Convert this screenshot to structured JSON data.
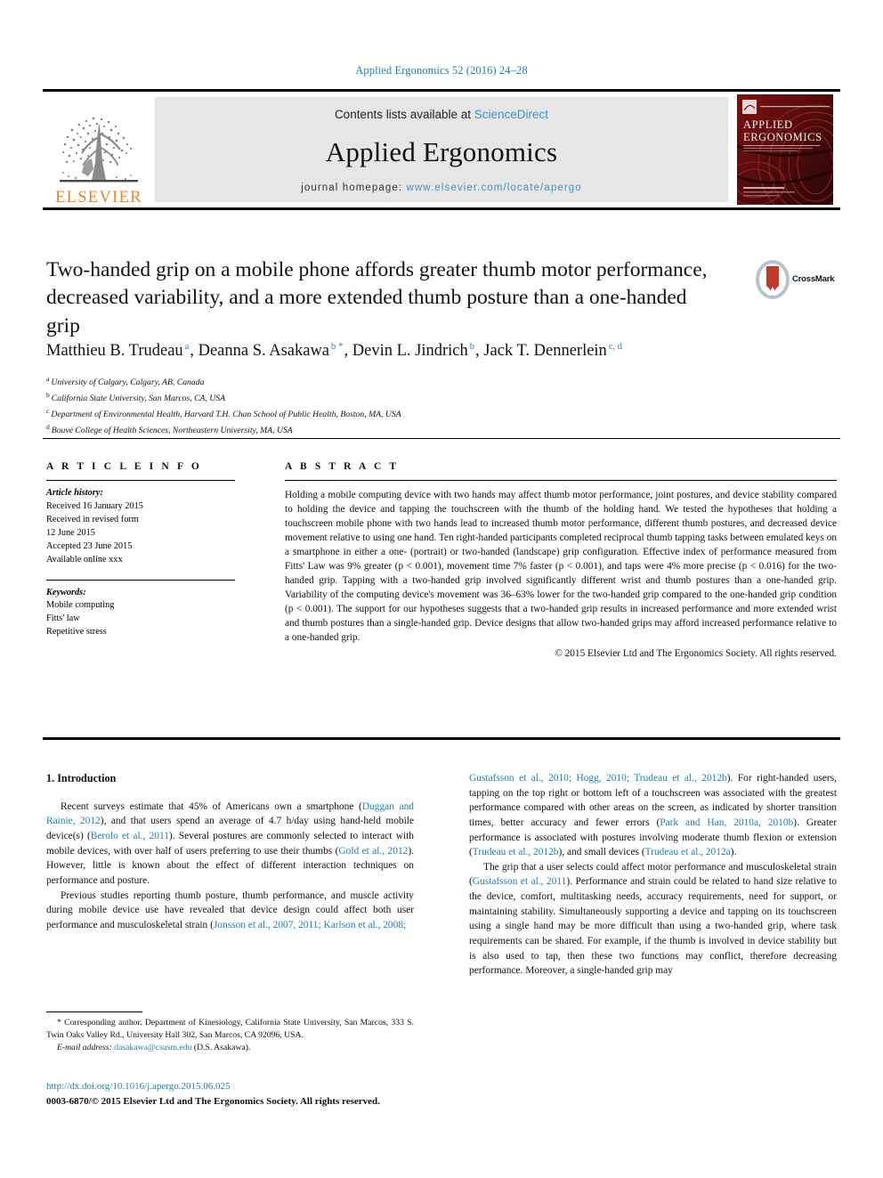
{
  "running_head": "Applied Ergonomics 52 (2016) 24–28",
  "masthead": {
    "elsevier_wordmark": "ELSEVIER",
    "contents_prefix": "Contents lists available at ",
    "contents_link": "ScienceDirect",
    "journal_name": "Applied Ergonomics",
    "homepage_prefix": "journal homepage: ",
    "homepage_url": "www.elsevier.com/locate/apergo",
    "cover_title_line1": "APPLIED",
    "cover_title_line2": "ERGONOMICS"
  },
  "crossmark": {
    "label": "CrossMark"
  },
  "article": {
    "title": "Two-handed grip on a mobile phone affords greater thumb motor performance, decreased variability, and a more extended thumb posture than a one-handed grip",
    "authors": [
      {
        "name": "Matthieu B. Trudeau",
        "marks": "a",
        "corresponding": false
      },
      {
        "name": "Deanna S. Asakawa",
        "marks": "b",
        "corresponding": true
      },
      {
        "name": "Devin L. Jindrich",
        "marks": "b",
        "corresponding": false
      },
      {
        "name": "Jack T. Dennerlein",
        "marks": "c, d",
        "corresponding": false
      }
    ],
    "affiliations": [
      {
        "mark": "a",
        "text": "University of Calgary, Calgary, AB, Canada"
      },
      {
        "mark": "b",
        "text": "California State University, San Marcos, CA, USA"
      },
      {
        "mark": "c",
        "text": "Department of Environmental Health, Harvard T.H. Chan School of Public Health, Boston, MA, USA"
      },
      {
        "mark": "d",
        "text": "Bouvé College of Health Sciences, Northeastern University, MA, USA"
      }
    ]
  },
  "article_info": {
    "heading": "A R T I C L E  I N F O",
    "history_label": "Article history:",
    "history_lines": [
      "Received 16 January 2015",
      "Received in revised form",
      "12 June 2015",
      "Accepted 23 June 2015",
      "Available online xxx"
    ],
    "keywords_label": "Keywords:",
    "keywords": [
      "Mobile computing",
      "Fitts' law",
      "Repetitive stress"
    ]
  },
  "abstract": {
    "heading": "A B S T R A C T",
    "body": "Holding a mobile computing device with two hands may affect thumb motor performance, joint postures, and device stability compared to holding the device and tapping the touchscreen with the thumb of the holding hand. We tested the hypotheses that holding a touchscreen mobile phone with two hands lead to increased thumb motor performance, different thumb postures, and decreased device movement relative to using one hand. Ten right-handed participants completed reciprocal thumb tapping tasks between emulated keys on a smartphone in either a one- (portrait) or two-handed (landscape) grip configuration. Effective index of performance measured from Fitts' Law was 9% greater (p < 0.001), movement time 7% faster (p < 0.001), and taps were 4% more precise (p < 0.016) for the two-handed grip. Tapping with a two-handed grip involved significantly different wrist and thumb postures than a one-handed grip. Variability of the computing device's movement was 36–63% lower for the two-handed grip compared to the one-handed grip condition (p < 0.001). The support for our hypotheses suggests that a two-handed grip results in increased performance and more extended wrist and thumb postures than a single-handed grip. Device designs that allow two-handed grips may afford increased performance relative to a one-handed grip.",
    "copyright": "© 2015 Elsevier Ltd and The Ergonomics Society. All rights reserved."
  },
  "introduction": {
    "heading": "1. Introduction",
    "left_paragraph_1_a": "Recent surveys estimate that 45% of Americans own a smartphone (",
    "left_ref_1": "Duggan and Rainie, 2012",
    "left_paragraph_1_b": "), and that users spend an average of 4.7 h/day using hand-held mobile device(s) (",
    "left_ref_2": "Berolo et al., 2011",
    "left_paragraph_1_c": "). Several postures are commonly selected to interact with mobile devices, with over half of users preferring to use their thumbs (",
    "left_ref_3": "Gold et al., 2012",
    "left_paragraph_1_d": "). However, little is known about the effect of different interaction techniques on performance and posture.",
    "left_paragraph_2_a": "Previous studies reporting thumb posture, thumb performance, and muscle activity during mobile device use have revealed that device design could affect both user performance and musculoskeletal strain (",
    "left_ref_4": "Jonsson et al., 2007, 2011; Karlson et al., 2008;",
    "right_ref_1": "Gustafsson et al., 2010; Hogg, 2010; Trudeau et al., 2012b",
    "right_paragraph_1_a": "). For right-handed users, tapping on the top right or bottom left of a touchscreen was associated with the greatest performance compared with other areas on the screen, as indicated by shorter transition times, better accuracy and fewer errors (",
    "right_ref_2": "Park and Han, 2010a, 2010b",
    "right_paragraph_1_b": "). Greater performance is associated with postures involving moderate thumb flexion or extension (",
    "right_ref_3": "Trudeau et al., 2012b",
    "right_paragraph_1_c": "), and small devices (",
    "right_ref_4": "Trudeau et al., 2012a",
    "right_paragraph_1_d": ").",
    "right_paragraph_2_a": "The grip that a user selects could affect motor performance and musculoskeletal strain (",
    "right_ref_5": "Gustafsson et al., 2011",
    "right_paragraph_2_b": "). Performance and strain could be related to hand size relative to the device, comfort, multitasking needs, accuracy requirements, need for support, or maintaining stability. Simultaneously supporting a device and tapping on its touchscreen using a single hand may be more difficult than using a two-handed grip, where task requirements can be shared. For example, if the thumb is involved in device stability but is also used to tap, then these two functions may conflict, therefore decreasing performance. Moreover, a single-handed grip may"
  },
  "footnote": {
    "marker": "*",
    "corresponding_text": "Corresponding author. Department of Kinesiology, California State University, San Marcos, 333 S. Twin Oaks Valley Rd., University Hall 302, San Marcos, CA 92096, USA.",
    "email_label": "E-mail address:",
    "email": "dasakawa@csusm.edu",
    "email_suffix": "(D.S. Asakawa)."
  },
  "footer": {
    "doi": "http://dx.doi.org/10.1016/j.apergo.2015.06.025",
    "issn_line": "0003-6870/© 2015 Elsevier Ltd and The Ergonomics Society. All rights reserved."
  },
  "colors": {
    "link_blue": "#1a7fb5",
    "elsevier_orange": "#F08421",
    "masthead_gray": "#e6e6e6",
    "cover_red": "#8c1616"
  }
}
